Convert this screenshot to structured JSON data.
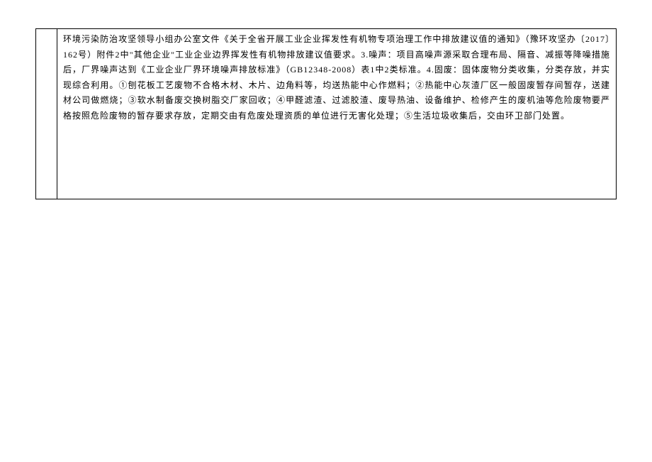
{
  "document": {
    "body_text": "环境污染防治攻坚领导小组办公室文件《关于全省开展工业企业挥发性有机物专项治理工作中排放建议值的通知》（豫环攻坚办〔2017〕162号）附件2中\"其他企业\"工业企业边界挥发性有机物排放建议值要求。3.噪声：项目高噪声源采取合理布局、隔音、减振等降噪措施后，厂界噪声达到《工业企业厂界环境噪声排放标准》（GB12348-2008）表1中2类标准。4.固废：固体废物分类收集，分类存放，并实现综合利用。①刨花板工艺废物不合格木材、木片、边角料等，均送热能中心作燃料；②热能中心灰渣厂区一般固废暂存间暂存，送建材公司做燃烧；③软水制备废交换树脂交厂家回收；④甲醛滤渣、过滤胶渣、废导热油、设备维护、检修产生的废机油等危险废物要严格按照危险废物的暂存要求存放，定期交由有危废处理资质的单位进行无害化处理；⑤生活垃圾收集后，交由环卫部门处置。"
  }
}
